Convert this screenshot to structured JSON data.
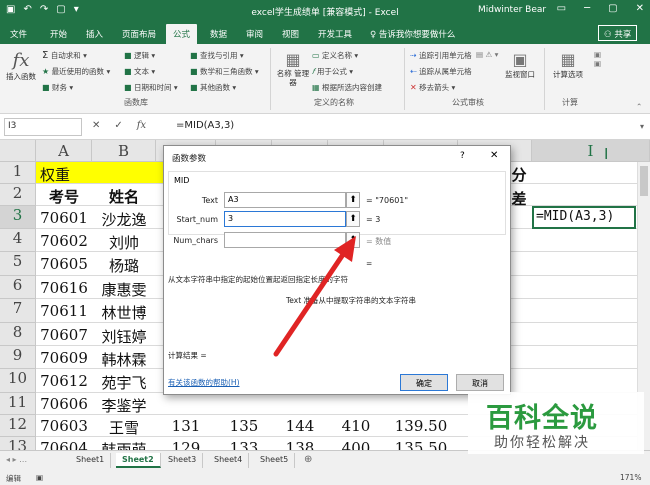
{
  "titlebar": {
    "title": "excel学生成绩单 [兼容模式] - Excel",
    "user": "Midwinter Bear"
  },
  "menu": {
    "tabs": [
      "文件",
      "开始",
      "插入",
      "页面布局",
      "公式",
      "数据",
      "审阅",
      "视图",
      "开发工具"
    ],
    "active_index": 4,
    "tell_me": "♀ 告诉我你想要做什么",
    "share": "共享"
  },
  "ribbon": {
    "insert_function": "插入函数",
    "autosum": "自动求和",
    "recent": "最近使用的函数",
    "financial": "财务",
    "logical": "逻辑",
    "text": "文本",
    "datetime": "日期和时间",
    "lookup": "查找与引用",
    "math": "数学和三角函数",
    "other": "其他函数",
    "group_library": "函数库",
    "name_manager": "名称 管理器",
    "define_name": "定义名称",
    "use_in_formula": "用于公式",
    "create_from_sel": "根据所选内容创建",
    "group_names": "定义的名称",
    "trace_precedents": "追踪引用单元格",
    "trace_dependents": "追踪从属单元格",
    "remove_arrows": "移去箭头",
    "group_audit": "公式审核",
    "watch_window": "监视窗口",
    "calc_options": "计算选项",
    "group_calc": "计算"
  },
  "formula_bar": {
    "name_box": "I3",
    "formula": "=MID(A3,3)"
  },
  "columns": [
    "A",
    "B",
    "C",
    "D",
    "E",
    "F",
    "G",
    "H",
    "I"
  ],
  "rows": [
    "1",
    "2",
    "3",
    "4",
    "5",
    "6",
    "7",
    "8",
    "9",
    "10",
    "11",
    "12",
    "13"
  ],
  "cells": {
    "a1": "权重",
    "a2": "考号",
    "b2": "姓名",
    "h2": "分",
    "h3": "差",
    "i3": "=MID(A3,3)",
    "ids": [
      "70601",
      "70602",
      "70605",
      "70616",
      "70611",
      "70607",
      "70609",
      "70612",
      "70606",
      "70603",
      "70604"
    ],
    "names": [
      "沙龙逸",
      "刘帅",
      "杨璐",
      "康惠雯",
      "林世博",
      "刘钰婷",
      "韩林霖",
      "苑宇飞",
      "李鉴学",
      "王雪",
      "韩雨萌"
    ],
    "row12": [
      "131",
      "135",
      "144",
      "410",
      "139.50"
    ],
    "row13": [
      "129",
      "133",
      "138",
      "400",
      "135.50"
    ]
  },
  "dialog": {
    "title": "函数参数",
    "help": "?",
    "close": "✕",
    "function": "MID",
    "args": [
      {
        "label": "Text",
        "value": "A3",
        "result": "= \"70601\""
      },
      {
        "label": "Start_num",
        "value": "3",
        "result": "= 3"
      },
      {
        "label": "Num_chars",
        "value": "",
        "result": "= 数值"
      }
    ],
    "eq": "=",
    "description": "从文本字符串中指定的起始位置起返回指定长度的字符",
    "arg_desc": "Text  准备从中提取字符串的文本字符串",
    "result_label": "计算结果 =",
    "help_link": "有关该函数的帮助(H)",
    "ok": "确定",
    "cancel": "取消"
  },
  "sheets": [
    "Sheet1",
    "Sheet2",
    "Sheet3",
    "Sheet4",
    "Sheet5"
  ],
  "active_sheet": 1,
  "status": {
    "mode": "编辑",
    "zoom": "171%"
  },
  "watermark": {
    "line1": "百科全说",
    "line2": "助你轻松解决"
  },
  "colors": {
    "excel_green": "#217346",
    "weight_fill": "#ffff00",
    "arrow": "#e02424"
  }
}
